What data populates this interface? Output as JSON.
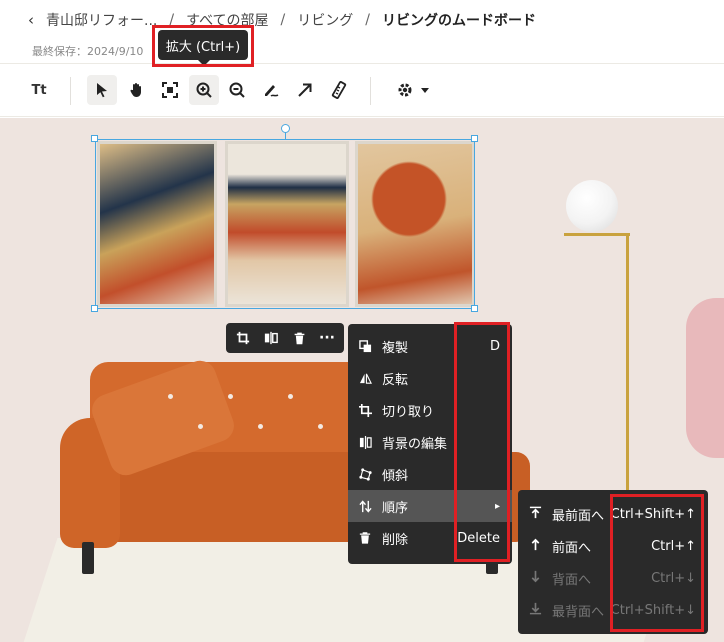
{
  "breadcrumb": {
    "back_icon": "‹",
    "items": [
      "青山邸リフォー...",
      "すべての部屋",
      "リビング"
    ],
    "separator": "/",
    "current": "リビングのムードボード"
  },
  "saved_text": "最終保存：2024/9/10",
  "tooltip": "拡大 (Ctrl+)",
  "toolbar": {
    "text_tool": "Tt",
    "tools": [
      "select-icon",
      "hand-icon",
      "fit-icon",
      "zoom-in-icon",
      "zoom-out-icon",
      "draw-icon",
      "arrow-icon",
      "ruler-icon"
    ],
    "settings": "gear-icon"
  },
  "minibar": {
    "more": "···"
  },
  "context_menu": {
    "items": [
      {
        "icon": "duplicate-icon",
        "label": "複製",
        "shortcut": "D"
      },
      {
        "icon": "flip-icon",
        "label": "反転",
        "shortcut": ""
      },
      {
        "icon": "crop-icon",
        "label": "切り取り",
        "shortcut": ""
      },
      {
        "icon": "background-edit-icon",
        "label": "背景の編集",
        "shortcut": ""
      },
      {
        "icon": "skew-icon",
        "label": "傾斜",
        "shortcut": ""
      },
      {
        "icon": "order-icon",
        "label": "順序",
        "shortcut": "▸"
      },
      {
        "icon": "trash-icon",
        "label": "削除",
        "shortcut": "Delete"
      }
    ]
  },
  "submenu": {
    "items": [
      {
        "icon": "bring-to-front-icon",
        "label": "最前面へ",
        "shortcut": "Ctrl+Shift+↑",
        "enabled": true
      },
      {
        "icon": "bring-forward-icon",
        "label": "前面へ",
        "shortcut": "Ctrl+↑",
        "enabled": true
      },
      {
        "icon": "send-backward-icon",
        "label": "背面へ",
        "shortcut": "Ctrl+↓",
        "enabled": false
      },
      {
        "icon": "send-to-back-icon",
        "label": "最背面へ",
        "shortcut": "Ctrl+Shift+↓",
        "enabled": false
      }
    ]
  },
  "colors": {
    "highlight": "#e02024",
    "selection": "#48a7e0",
    "menu_bg": "#2a2a2a",
    "canvas_bg": "#eee4df",
    "sofa": "#d46a2d"
  }
}
